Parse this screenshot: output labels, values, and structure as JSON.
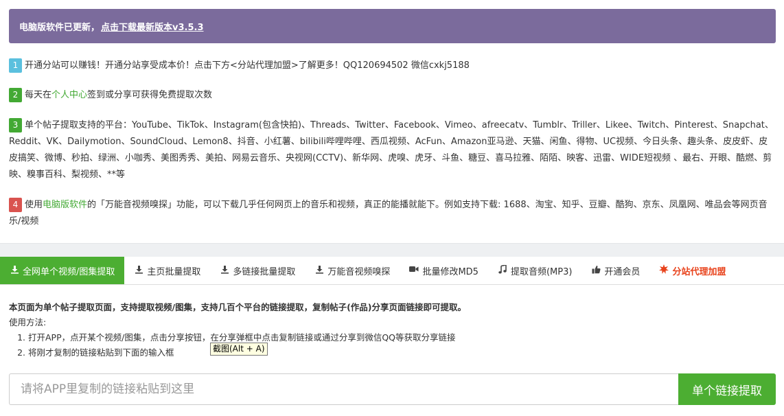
{
  "banner": {
    "text": "电脑版软件已更新，",
    "link": "点击下载最新版本v3.5.3"
  },
  "notices": [
    {
      "num": "1",
      "text": "开通分站可以赚钱！开通分站享受成本价！点击下方<分站代理加盟>了解更多！QQ120694502 微信cxkj5188"
    },
    {
      "num": "2",
      "pre": "每天在",
      "link": "个人中心",
      "post": "签到或分享可获得免费提取次数"
    },
    {
      "num": "3",
      "text": "单个帖子提取支持的平台：YouTube、TikTok、Instagram(包含快拍)、Threads、Twitter、Facebook、Vimeo、afreecatv、Tumblr、Triller、Likee、Twitch、Pinterest、Snapchat、Reddit、VK、Dailymotion、SoundCloud、Lemon8、抖音、小红薯、bilibili哔哩哔哩、西瓜视频、AcFun、Amazon亚马逊、天猫、闲鱼、得物、UC视频、今日头条、趣头条、皮皮虾、皮皮搞笑、微博、秒拍、绿洲、小咖秀、美图秀秀、美拍、网易云音乐、央视网(CCTV)、新华网、虎嗅、虎牙、斗鱼、糖豆、喜马拉雅、陌陌、映客、迅雷、WIDE短视频 、最右、开眼、酷燃、剪映、糗事百科、梨视频、**等"
    },
    {
      "num": "4",
      "pre": "使用",
      "link": "电脑版软件",
      "post": "的「万能音视频嗅探」功能，可以下载几乎任何网页上的音乐和视频，真正的能播就能下。例如支持下载: 1688、淘宝、知乎、豆瓣、酷狗、京东、凤凰网、唯品会等网页音乐/视频"
    }
  ],
  "tabs": [
    {
      "label": "全网单个视频/图集提取",
      "icon": "download-icon"
    },
    {
      "label": "主页批量提取",
      "icon": "download-icon"
    },
    {
      "label": "多链接批量提取",
      "icon": "download-icon"
    },
    {
      "label": "万能音视频嗅探",
      "icon": "download-icon"
    },
    {
      "label": "批量修改MD5",
      "icon": "video-camera-icon"
    },
    {
      "label": "提取音频(MP3)",
      "icon": "music-note-icon"
    },
    {
      "label": "开通会员",
      "icon": "thumbs-up-icon"
    },
    {
      "label": "分站代理加盟",
      "icon": "star-burst-icon"
    }
  ],
  "description": {
    "headline": "本页面为单个帖子提取页面，支持提取视频/图集，支持几百个平台的链接提取，复制帖子(作品)分享页面链接即可提取。",
    "usage_label": "使用方法:",
    "steps": [
      "打开APP，点开某个视频/图集，点击分享按钮，在分享弹框中点击复制链接或通过分享到微信QQ等获取分享链接",
      "将刚才复制的链接粘贴到下面的输入框"
    ]
  },
  "tooltip": "截图(Alt + A)",
  "input": {
    "placeholder": "请将APP里复制的链接粘贴到这里",
    "value": ""
  },
  "submit_label": "单个链接提取",
  "colors": {
    "banner_bg": "#7b6b9c",
    "accent_green": "#4cae32",
    "agent_red": "#e8421b"
  }
}
